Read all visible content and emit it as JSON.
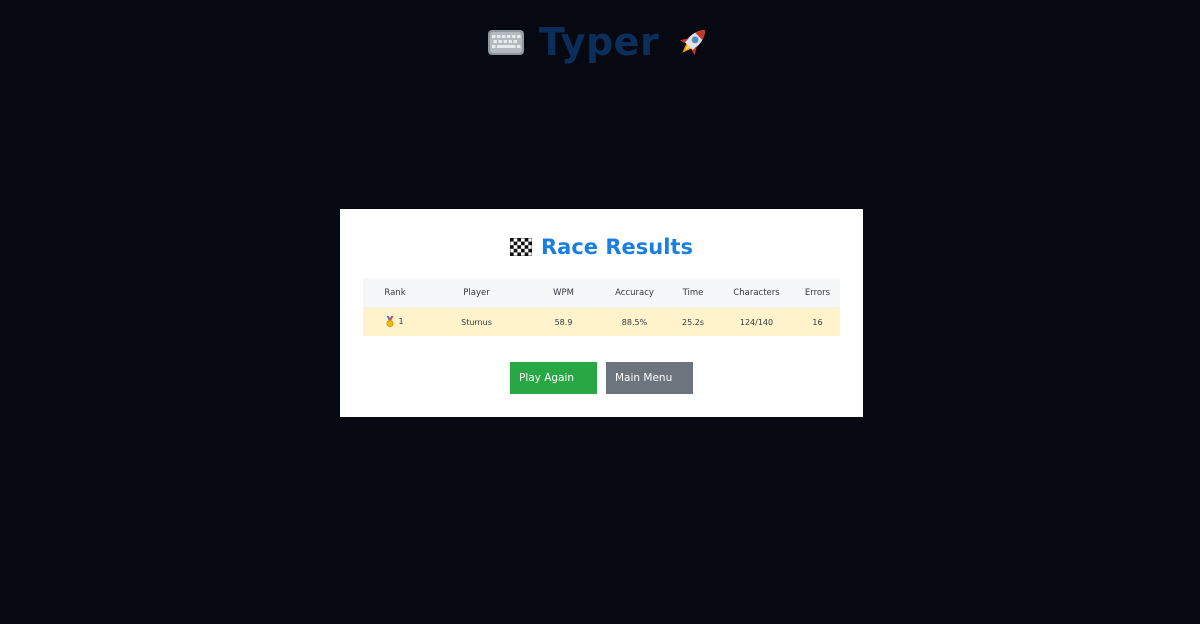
{
  "header": {
    "title": "Typer",
    "left_icon": "keyboard-icon",
    "right_icon": "rocket-icon"
  },
  "results": {
    "title": "Race Results",
    "title_icon": "checkered-flag-icon",
    "columns": [
      "Rank",
      "Player",
      "WPM",
      "Accuracy",
      "Time",
      "Characters",
      "Errors"
    ],
    "rows": [
      {
        "rank": "1",
        "rank_icon": "medal-icon",
        "player": "Sturnus",
        "wpm": "58.9",
        "accuracy": "88.5%",
        "time": "25.2s",
        "characters": "124/140",
        "errors": "16"
      }
    ]
  },
  "buttons": {
    "play_again": "Play Again",
    "main_menu": "Main Menu"
  },
  "colors": {
    "page_background": "#060812",
    "header_title": "#0b2f5a",
    "modal_title": "#1a7fe0",
    "row_highlight": "#fff3cc",
    "play_again": "#28a745",
    "main_menu": "#6c757d"
  }
}
